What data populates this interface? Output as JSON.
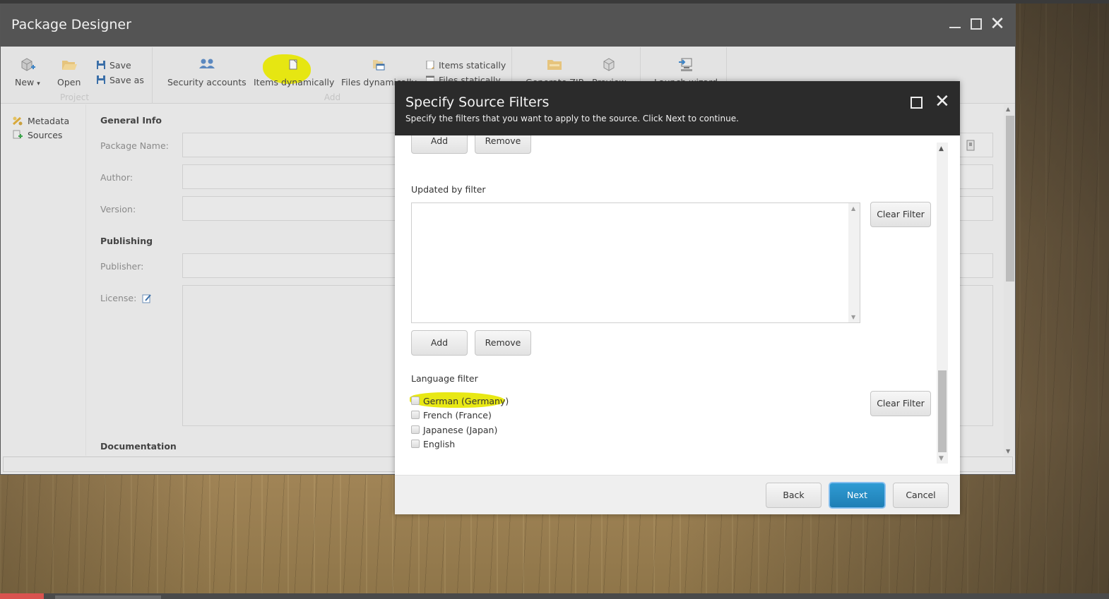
{
  "window": {
    "title": "Package Designer",
    "controls": {
      "minimize": "minimize",
      "maximize": "maximize",
      "close": "✕"
    }
  },
  "ribbon": {
    "groups": [
      {
        "label": "Project",
        "buttons": [
          "New",
          "Open"
        ],
        "small": [
          "Save",
          "Save as"
        ]
      },
      {
        "label": "Add",
        "buttons": [
          "Security accounts",
          "Items dynamically",
          "Files dynamically"
        ],
        "small": [
          "Items statically",
          "Files statically"
        ]
      },
      {
        "label": "",
        "buttons": [
          "Generate ZIP",
          "Preview"
        ]
      },
      {
        "label": "",
        "buttons": [
          "Launch wizard"
        ]
      }
    ],
    "new_label": "New",
    "new_caret": "▾",
    "open_label": "Open",
    "save_label": "Save",
    "save_as_label": "Save as",
    "project_group": "Project",
    "security_label": "Security accounts",
    "items_dyn_label": "Items dynamically",
    "files_dyn_label": "Files dynamically",
    "items_static_label": "Items statically",
    "files_static_label": "Files statically",
    "add_group": "Add",
    "zip_label": "Generate ZIP",
    "preview_label": "Preview",
    "wizard_label": "Launch wizard"
  },
  "sidebar": {
    "items": [
      {
        "label": "Metadata",
        "icon": "metadata-icon"
      },
      {
        "label": "Sources",
        "icon": "sources-icon"
      }
    ]
  },
  "form": {
    "general_info": "General Info",
    "package_name_label": "Package Name:",
    "package_name_value": "",
    "author_label": "Author:",
    "author_value": "",
    "version_label": "Version:",
    "version_value": "",
    "publishing": "Publishing",
    "publisher_label": "Publisher:",
    "publisher_value": "",
    "license_label": "License:",
    "license_value": "",
    "documentation": "Documentation"
  },
  "dialog": {
    "title": "Specify Source Filters",
    "subtitle": "Specify the filters that you want to apply to the source. Click Next to continue.",
    "close": "✕",
    "add_label": "Add",
    "remove_label": "Remove",
    "updated_by_label": "Updated by filter",
    "clear_filter_label": "Clear Filter",
    "language_filter_label": "Language filter",
    "languages": [
      {
        "label": "German (Germany)",
        "checked": false,
        "highlighted": true
      },
      {
        "label": "French (France)",
        "checked": false
      },
      {
        "label": "Japanese (Japan)",
        "checked": false
      },
      {
        "label": "English",
        "checked": false
      }
    ],
    "footer": {
      "back": "Back",
      "next": "Next",
      "cancel": "Cancel"
    }
  },
  "colors": {
    "titlebar": "#545454",
    "dialog_header": "#2b2b2b",
    "primary_button": "#2a8fc6",
    "highlight": "#e6e600"
  }
}
